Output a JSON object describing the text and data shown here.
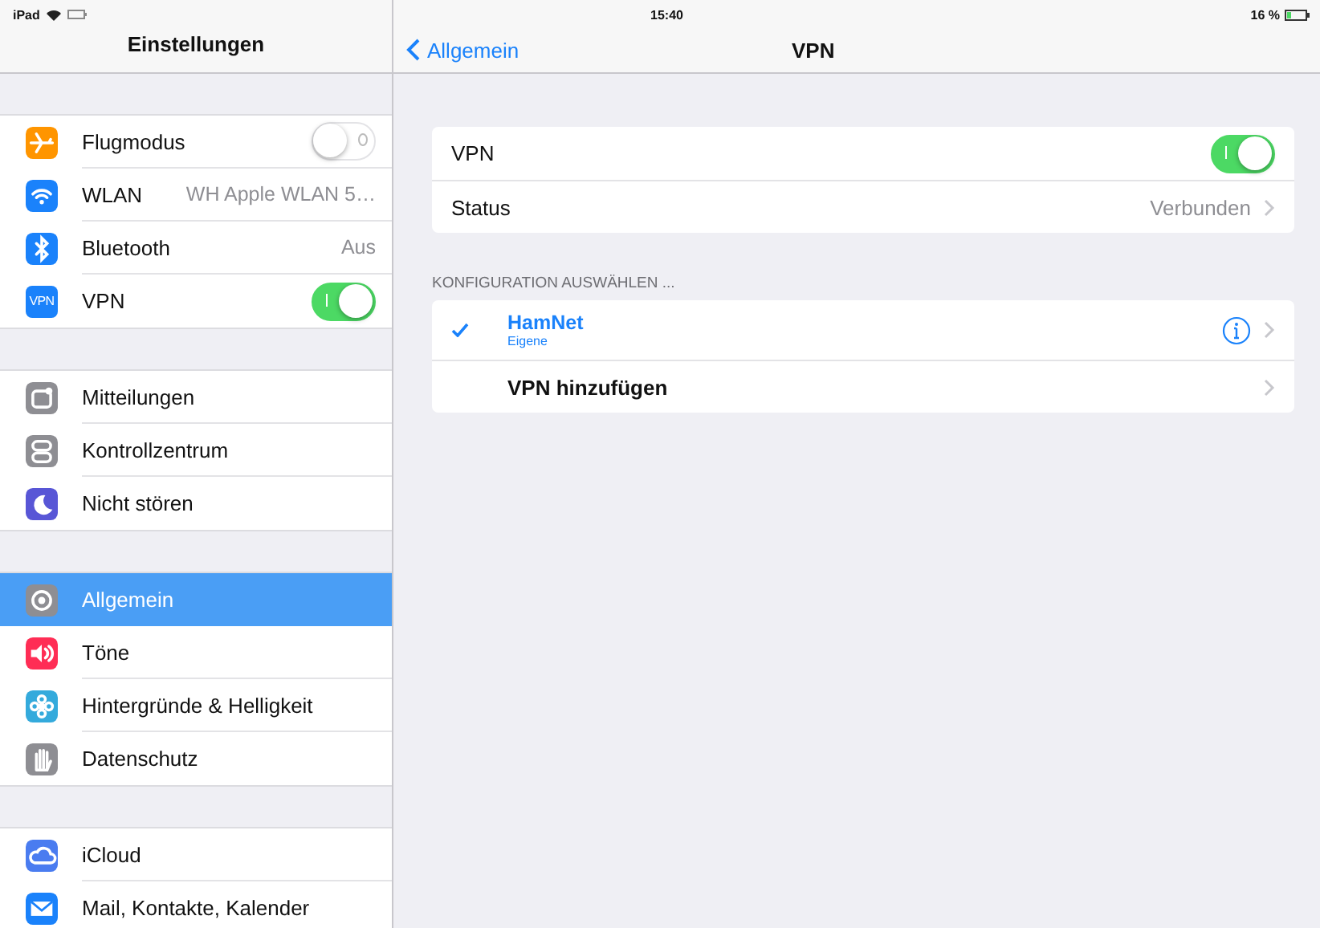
{
  "status_bar": {
    "device": "iPad",
    "time": "15:40",
    "battery": "16 %"
  },
  "sidebar": {
    "title": "Einstellungen",
    "groups": [
      {
        "items": [
          {
            "label": "Flugmodus",
            "kind": "toggle",
            "on": false,
            "selected": false,
            "color": "#ff9500"
          },
          {
            "label": "WLAN",
            "kind": "value",
            "value": "WH Apple WLAN 5…",
            "selected": false,
            "color": "#1a82fb"
          },
          {
            "label": "Bluetooth",
            "kind": "value",
            "value": "Aus",
            "selected": false,
            "color": "#1a82fb"
          },
          {
            "label": "VPN",
            "kind": "toggle",
            "on": true,
            "badge": "VPN",
            "selected": false,
            "color": "#1a82fb"
          }
        ]
      },
      {
        "items": [
          {
            "label": "Mitteilungen",
            "kind": "plain",
            "selected": false,
            "color": "#8e8e93"
          },
          {
            "label": "Kontrollzentrum",
            "kind": "plain",
            "selected": false,
            "color": "#8e8e93"
          },
          {
            "label": "Nicht stören",
            "kind": "plain",
            "selected": false,
            "color": "#5856d6"
          }
        ]
      },
      {
        "items": [
          {
            "label": "Allgemein",
            "kind": "plain",
            "selected": true,
            "color": "#8e8e93"
          },
          {
            "label": "Töne",
            "kind": "plain",
            "selected": false,
            "color": "#ff2d55"
          },
          {
            "label": "Hintergründe & Helligkeit",
            "kind": "plain",
            "selected": false,
            "color": "#34aadc"
          },
          {
            "label": "Datenschutz",
            "kind": "plain",
            "selected": false,
            "color": "#8e8e93"
          }
        ]
      },
      {
        "items": [
          {
            "label": "iCloud",
            "kind": "plain",
            "selected": false,
            "color": "#4a7cf0"
          },
          {
            "label": "Mail, Kontakte, Kalender",
            "kind": "plain",
            "selected": false,
            "color": "#1a82fb"
          }
        ]
      }
    ]
  },
  "detail": {
    "back": "Allgemein",
    "title": "VPN",
    "sections": [
      {
        "rows": [
          {
            "kind": "toggle",
            "label": "VPN",
            "on": true
          },
          {
            "kind": "disclosure",
            "label": "Status",
            "value": "Verbunden"
          }
        ]
      },
      {
        "header": "KONFIGURATION AUSWÄHLEN ...",
        "rows": [
          {
            "kind": "config",
            "label": "HamNet",
            "subtitle": "Eigene",
            "checked": true
          },
          {
            "kind": "action",
            "label": "VPN hinzufügen"
          }
        ]
      }
    ]
  }
}
